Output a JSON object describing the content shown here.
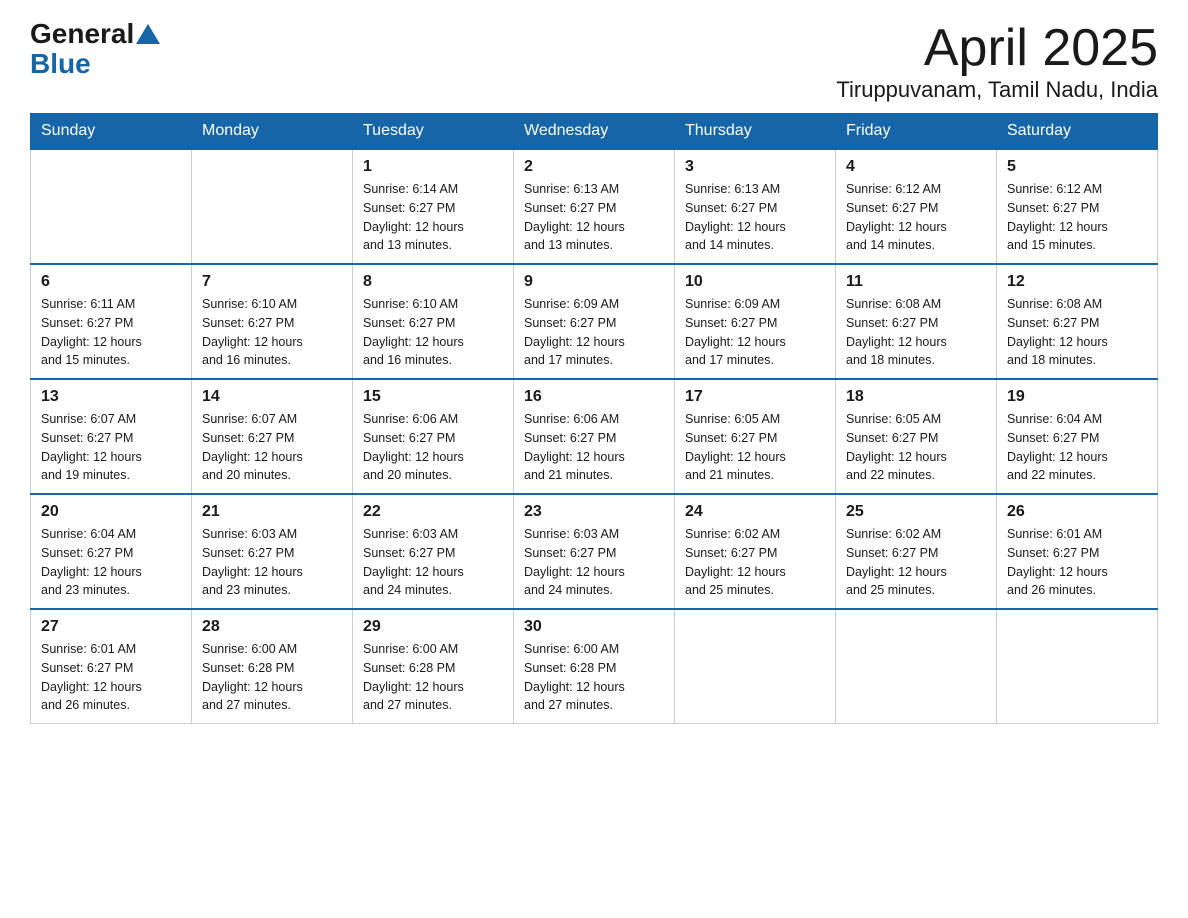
{
  "header": {
    "logo": {
      "general": "General",
      "blue": "Blue"
    },
    "title": "April 2025",
    "location": "Tiruppuvanam, Tamil Nadu, India"
  },
  "days_of_week": [
    "Sunday",
    "Monday",
    "Tuesday",
    "Wednesday",
    "Thursday",
    "Friday",
    "Saturday"
  ],
  "weeks": [
    [
      {
        "day": "",
        "info": ""
      },
      {
        "day": "",
        "info": ""
      },
      {
        "day": "1",
        "info": "Sunrise: 6:14 AM\nSunset: 6:27 PM\nDaylight: 12 hours\nand 13 minutes."
      },
      {
        "day": "2",
        "info": "Sunrise: 6:13 AM\nSunset: 6:27 PM\nDaylight: 12 hours\nand 13 minutes."
      },
      {
        "day": "3",
        "info": "Sunrise: 6:13 AM\nSunset: 6:27 PM\nDaylight: 12 hours\nand 14 minutes."
      },
      {
        "day": "4",
        "info": "Sunrise: 6:12 AM\nSunset: 6:27 PM\nDaylight: 12 hours\nand 14 minutes."
      },
      {
        "day": "5",
        "info": "Sunrise: 6:12 AM\nSunset: 6:27 PM\nDaylight: 12 hours\nand 15 minutes."
      }
    ],
    [
      {
        "day": "6",
        "info": "Sunrise: 6:11 AM\nSunset: 6:27 PM\nDaylight: 12 hours\nand 15 minutes."
      },
      {
        "day": "7",
        "info": "Sunrise: 6:10 AM\nSunset: 6:27 PM\nDaylight: 12 hours\nand 16 minutes."
      },
      {
        "day": "8",
        "info": "Sunrise: 6:10 AM\nSunset: 6:27 PM\nDaylight: 12 hours\nand 16 minutes."
      },
      {
        "day": "9",
        "info": "Sunrise: 6:09 AM\nSunset: 6:27 PM\nDaylight: 12 hours\nand 17 minutes."
      },
      {
        "day": "10",
        "info": "Sunrise: 6:09 AM\nSunset: 6:27 PM\nDaylight: 12 hours\nand 17 minutes."
      },
      {
        "day": "11",
        "info": "Sunrise: 6:08 AM\nSunset: 6:27 PM\nDaylight: 12 hours\nand 18 minutes."
      },
      {
        "day": "12",
        "info": "Sunrise: 6:08 AM\nSunset: 6:27 PM\nDaylight: 12 hours\nand 18 minutes."
      }
    ],
    [
      {
        "day": "13",
        "info": "Sunrise: 6:07 AM\nSunset: 6:27 PM\nDaylight: 12 hours\nand 19 minutes."
      },
      {
        "day": "14",
        "info": "Sunrise: 6:07 AM\nSunset: 6:27 PM\nDaylight: 12 hours\nand 20 minutes."
      },
      {
        "day": "15",
        "info": "Sunrise: 6:06 AM\nSunset: 6:27 PM\nDaylight: 12 hours\nand 20 minutes."
      },
      {
        "day": "16",
        "info": "Sunrise: 6:06 AM\nSunset: 6:27 PM\nDaylight: 12 hours\nand 21 minutes."
      },
      {
        "day": "17",
        "info": "Sunrise: 6:05 AM\nSunset: 6:27 PM\nDaylight: 12 hours\nand 21 minutes."
      },
      {
        "day": "18",
        "info": "Sunrise: 6:05 AM\nSunset: 6:27 PM\nDaylight: 12 hours\nand 22 minutes."
      },
      {
        "day": "19",
        "info": "Sunrise: 6:04 AM\nSunset: 6:27 PM\nDaylight: 12 hours\nand 22 minutes."
      }
    ],
    [
      {
        "day": "20",
        "info": "Sunrise: 6:04 AM\nSunset: 6:27 PM\nDaylight: 12 hours\nand 23 minutes."
      },
      {
        "day": "21",
        "info": "Sunrise: 6:03 AM\nSunset: 6:27 PM\nDaylight: 12 hours\nand 23 minutes."
      },
      {
        "day": "22",
        "info": "Sunrise: 6:03 AM\nSunset: 6:27 PM\nDaylight: 12 hours\nand 24 minutes."
      },
      {
        "day": "23",
        "info": "Sunrise: 6:03 AM\nSunset: 6:27 PM\nDaylight: 12 hours\nand 24 minutes."
      },
      {
        "day": "24",
        "info": "Sunrise: 6:02 AM\nSunset: 6:27 PM\nDaylight: 12 hours\nand 25 minutes."
      },
      {
        "day": "25",
        "info": "Sunrise: 6:02 AM\nSunset: 6:27 PM\nDaylight: 12 hours\nand 25 minutes."
      },
      {
        "day": "26",
        "info": "Sunrise: 6:01 AM\nSunset: 6:27 PM\nDaylight: 12 hours\nand 26 minutes."
      }
    ],
    [
      {
        "day": "27",
        "info": "Sunrise: 6:01 AM\nSunset: 6:27 PM\nDaylight: 12 hours\nand 26 minutes."
      },
      {
        "day": "28",
        "info": "Sunrise: 6:00 AM\nSunset: 6:28 PM\nDaylight: 12 hours\nand 27 minutes."
      },
      {
        "day": "29",
        "info": "Sunrise: 6:00 AM\nSunset: 6:28 PM\nDaylight: 12 hours\nand 27 minutes."
      },
      {
        "day": "30",
        "info": "Sunrise: 6:00 AM\nSunset: 6:28 PM\nDaylight: 12 hours\nand 27 minutes."
      },
      {
        "day": "",
        "info": ""
      },
      {
        "day": "",
        "info": ""
      },
      {
        "day": "",
        "info": ""
      }
    ]
  ]
}
